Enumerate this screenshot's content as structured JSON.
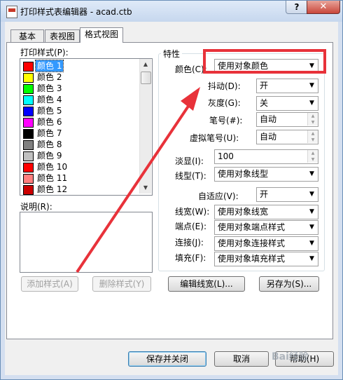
{
  "window": {
    "title": "打印样式表编辑器 - acad.ctb",
    "help_label": "?",
    "close_label": "✕"
  },
  "tabs": [
    {
      "label": "基本"
    },
    {
      "label": "表视图"
    },
    {
      "label": "格式视图"
    }
  ],
  "styles_list": {
    "label": "打印样式(P):",
    "items": [
      {
        "label": "颜色 1",
        "color": "#ff0000"
      },
      {
        "label": "颜色 2",
        "color": "#ffff00"
      },
      {
        "label": "颜色 3",
        "color": "#00ff00"
      },
      {
        "label": "颜色 4",
        "color": "#00ffff"
      },
      {
        "label": "颜色 5",
        "color": "#0000ff"
      },
      {
        "label": "颜色 6",
        "color": "#ff00ff"
      },
      {
        "label": "颜色 7",
        "color": "#000000"
      },
      {
        "label": "颜色 8",
        "color": "#808080"
      },
      {
        "label": "颜色 9",
        "color": "#c0c0c0"
      },
      {
        "label": "颜色 10",
        "color": "#ff0000"
      },
      {
        "label": "颜色 11",
        "color": "#ff7f7f"
      },
      {
        "label": "颜色 12",
        "color": "#cc0000"
      }
    ],
    "selected_index": 0
  },
  "description": {
    "label": "说明(R):",
    "value": ""
  },
  "properties": {
    "group_label": "特性",
    "color": {
      "label": "颜色(C):",
      "value": "使用对象颜色"
    },
    "dither": {
      "label": "抖动(D):",
      "value": "开"
    },
    "grayscale": {
      "label": "灰度(G):",
      "value": "关"
    },
    "pen": {
      "label": "笔号(#):",
      "value": "自动"
    },
    "virtual_pen": {
      "label": "虚拟笔号(U):",
      "value": "自动"
    },
    "screening": {
      "label": "淡显(I):",
      "value": "100"
    },
    "linetype": {
      "label": "线型(T):",
      "value": "使用对象线型"
    },
    "adaptive": {
      "label": "自适应(V):",
      "value": "开"
    },
    "lineweight": {
      "label": "线宽(W):",
      "value": "使用对象线宽"
    },
    "line_end": {
      "label": "端点(E):",
      "value": "使用对象端点样式"
    },
    "line_join": {
      "label": "连接(J):",
      "value": "使用对象连接样式"
    },
    "fill": {
      "label": "填充(F):",
      "value": "使用对象填充样式"
    }
  },
  "buttons": {
    "add_style": "添加样式(A)",
    "delete_style": "删除样式(Y)",
    "edit_lineweights": "编辑线宽(L)...",
    "save_as": "另存为(S)...",
    "save_close": "保存并关闭",
    "cancel": "取消",
    "help": "帮助(H)"
  },
  "watermark": "Bai经验",
  "annotation_color": "#e8323a"
}
